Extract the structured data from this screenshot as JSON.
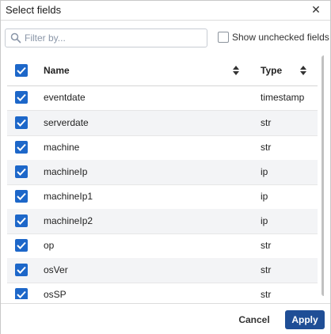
{
  "dialog": {
    "title": "Select fields",
    "close_icon": "close-icon"
  },
  "search": {
    "placeholder": "Filter by...",
    "value": "",
    "icon": "search-icon"
  },
  "show_unchecked": {
    "label": "Show unchecked fields",
    "checked": false
  },
  "table": {
    "select_all_checked": true,
    "columns": {
      "name": "Name",
      "type": "Type"
    },
    "rows": [
      {
        "name": "eventdate",
        "type": "timestamp",
        "checked": true
      },
      {
        "name": "serverdate",
        "type": "str",
        "checked": true
      },
      {
        "name": "machine",
        "type": "str",
        "checked": true
      },
      {
        "name": "machineIp",
        "type": "ip",
        "checked": true
      },
      {
        "name": "machineIp1",
        "type": "ip",
        "checked": true
      },
      {
        "name": "machineIp2",
        "type": "ip",
        "checked": true
      },
      {
        "name": "op",
        "type": "str",
        "checked": true
      },
      {
        "name": "osVer",
        "type": "str",
        "checked": true
      },
      {
        "name": "osSP",
        "type": "str",
        "checked": true
      }
    ]
  },
  "footer": {
    "cancel_label": "Cancel",
    "apply_label": "Apply"
  },
  "colors": {
    "checkbox": "#1d67c9",
    "apply_button": "#1f4e96",
    "row_alt": "#f3f4f6"
  }
}
